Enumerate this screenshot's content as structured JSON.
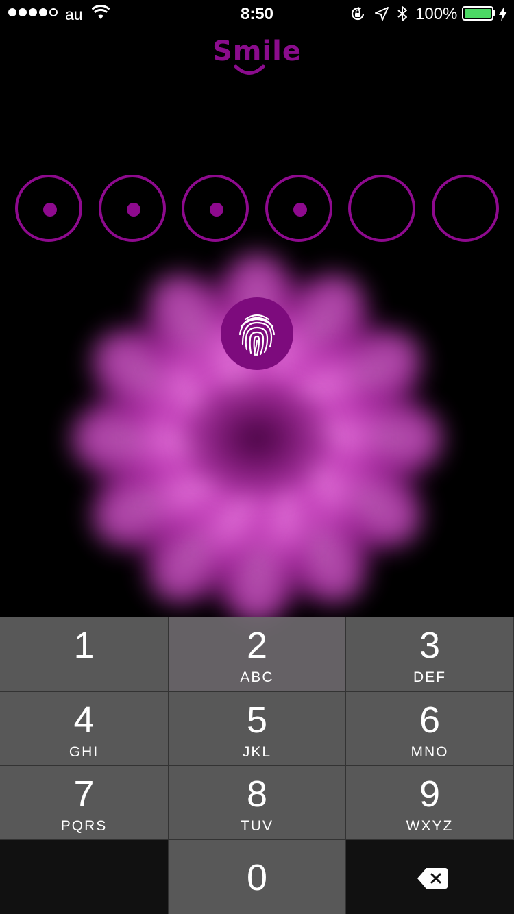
{
  "status_bar": {
    "carrier": "au",
    "time": "8:50",
    "battery_percent": "100%",
    "signal_bars_filled": 4,
    "signal_bars_total": 5,
    "battery_level": 1.0,
    "battery_color": "#4cd964",
    "icons": [
      "wifi-icon",
      "rotation-lock-icon",
      "location-icon",
      "bluetooth-icon",
      "charging-icon"
    ]
  },
  "app": {
    "logo_text": "Smile",
    "accent_color": "#8e0a8e"
  },
  "passcode": {
    "length": 6,
    "entered": 4
  },
  "touch_id": {
    "icon": "fingerprint-icon"
  },
  "keypad": {
    "keys": [
      {
        "num": "1",
        "letters": ""
      },
      {
        "num": "2",
        "letters": "ABC"
      },
      {
        "num": "3",
        "letters": "DEF"
      },
      {
        "num": "4",
        "letters": "GHI"
      },
      {
        "num": "5",
        "letters": "JKL"
      },
      {
        "num": "6",
        "letters": "MNO"
      },
      {
        "num": "7",
        "letters": "PQRS"
      },
      {
        "num": "8",
        "letters": "TUV"
      },
      {
        "num": "9",
        "letters": "WXYZ"
      },
      {
        "num": "0",
        "letters": ""
      }
    ],
    "delete_icon": "backspace-icon"
  }
}
